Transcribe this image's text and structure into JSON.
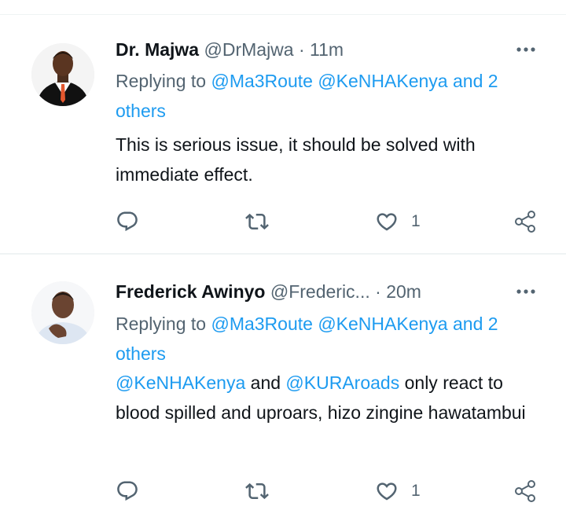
{
  "tweets": [
    {
      "display_name": "Dr. Majwa",
      "handle": "@DrMajwa",
      "separator": "·",
      "time": "11m",
      "replying_prefix": "Replying to",
      "replying_mentions": [
        "@Ma3Route",
        "@KeNHAKenya"
      ],
      "replying_others": "and 2 others",
      "text_parts": [
        {
          "text": "This is serious issue, it should be solved with immediate effect.",
          "type": "text"
        }
      ],
      "like_count": "1",
      "icons": {
        "reply": "reply-icon",
        "retweet": "retweet-icon",
        "like": "heart-icon",
        "share": "share-icon",
        "more": "more-icon"
      }
    },
    {
      "display_name": "Frederick Awinyo",
      "handle": "@Frederic...",
      "separator": "·",
      "time": "20m",
      "replying_prefix": "Replying to",
      "replying_mentions": [
        "@Ma3Route",
        "@KeNHAKenya"
      ],
      "replying_others": "and 2 others",
      "text_parts": [
        {
          "text": "@KeNHAKenya",
          "type": "mention"
        },
        {
          "text": " and ",
          "type": "text"
        },
        {
          "text": "@KURAroads",
          "type": "mention"
        },
        {
          "text": " only react to blood spilled and uproars, hizo zingine hawatambui",
          "type": "text"
        }
      ],
      "like_count": "1",
      "icons": {
        "reply": "reply-icon",
        "retweet": "retweet-icon",
        "like": "heart-icon",
        "share": "share-icon",
        "more": "more-icon"
      }
    }
  ],
  "colors": {
    "link": "#1d9bf0",
    "secondary_text": "#536471",
    "primary_text": "#0f1419",
    "divider": "#eff3f4"
  }
}
